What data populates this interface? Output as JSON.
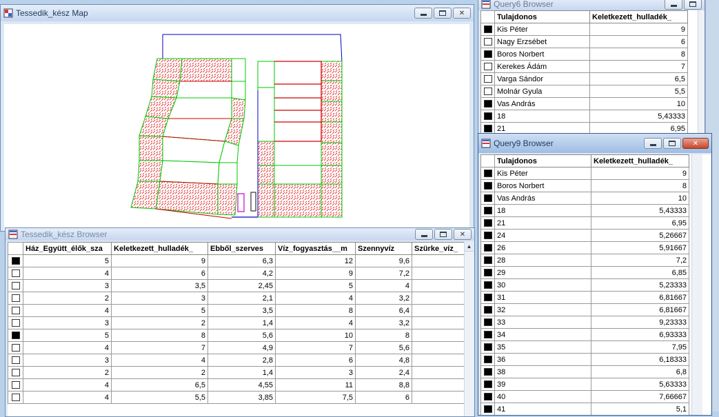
{
  "map_window": {
    "title": "Tessedik_kész Map"
  },
  "browser_window": {
    "title": "Tessedik_kész Browser",
    "columns": [
      "Ház_Együtt_élők_sza",
      "Keletkezett_hulladék_",
      "Ebből_szerves",
      "Víz_fogyasztás__m",
      "Szennyvíz",
      "Szürke_víz_"
    ],
    "rows": [
      {
        "selected": true,
        "cells": [
          "5",
          "9",
          "6,3",
          "12",
          "9,6",
          ""
        ]
      },
      {
        "selected": false,
        "cells": [
          "4",
          "6",
          "4,2",
          "9",
          "7,2",
          ""
        ]
      },
      {
        "selected": false,
        "cells": [
          "3",
          "3,5",
          "2,45",
          "5",
          "4",
          ""
        ]
      },
      {
        "selected": false,
        "cells": [
          "2",
          "3",
          "2,1",
          "4",
          "3,2",
          ""
        ]
      },
      {
        "selected": false,
        "cells": [
          "4",
          "5",
          "3,5",
          "8",
          "6,4",
          ""
        ]
      },
      {
        "selected": false,
        "cells": [
          "3",
          "2",
          "1,4",
          "4",
          "3,2",
          ""
        ]
      },
      {
        "selected": true,
        "cells": [
          "5",
          "8",
          "5,6",
          "10",
          "8",
          ""
        ]
      },
      {
        "selected": false,
        "cells": [
          "4",
          "7",
          "4,9",
          "7",
          "5,6",
          ""
        ]
      },
      {
        "selected": false,
        "cells": [
          "3",
          "4",
          "2,8",
          "6",
          "4,8",
          ""
        ]
      },
      {
        "selected": false,
        "cells": [
          "2",
          "2",
          "1,4",
          "3",
          "2,4",
          ""
        ]
      },
      {
        "selected": false,
        "cells": [
          "4",
          "6,5",
          "4,55",
          "11",
          "8,8",
          ""
        ]
      },
      {
        "selected": false,
        "cells": [
          "4",
          "5,5",
          "3,85",
          "7,5",
          "6",
          ""
        ]
      }
    ]
  },
  "q6_window": {
    "title": "Query6 Browser",
    "columns": [
      "Tulajdonos",
      "Keletkezett_hulladék_"
    ],
    "rows": [
      {
        "selected": true,
        "cells": [
          "Kis Péter",
          "9"
        ]
      },
      {
        "selected": false,
        "cells": [
          "Nagy Erzsébet",
          "6"
        ]
      },
      {
        "selected": true,
        "cells": [
          "Boros Norbert",
          "8"
        ]
      },
      {
        "selected": false,
        "cells": [
          "Kerekes Ádám",
          "7"
        ]
      },
      {
        "selected": false,
        "cells": [
          "Varga Sándor",
          "6,5"
        ]
      },
      {
        "selected": false,
        "cells": [
          "Molnár Gyula",
          "5,5"
        ]
      },
      {
        "selected": true,
        "cells": [
          "Vas András",
          "10"
        ]
      },
      {
        "selected": true,
        "cells": [
          "18",
          "5,43333"
        ]
      },
      {
        "selected": true,
        "cells": [
          "21",
          "6,95"
        ]
      }
    ]
  },
  "q9_window": {
    "title": "Query9 Browser",
    "columns": [
      "Tulajdonos",
      "Keletkezett_hulladék_"
    ],
    "rows": [
      {
        "selected": true,
        "cells": [
          "Kis Péter",
          "9"
        ]
      },
      {
        "selected": true,
        "cells": [
          "Boros Norbert",
          "8"
        ]
      },
      {
        "selected": true,
        "cells": [
          "Vas András",
          "10"
        ]
      },
      {
        "selected": true,
        "cells": [
          "18",
          "5,43333"
        ]
      },
      {
        "selected": true,
        "cells": [
          "21",
          "6,95"
        ]
      },
      {
        "selected": true,
        "cells": [
          "24",
          "5,26667"
        ]
      },
      {
        "selected": true,
        "cells": [
          "26",
          "5,91667"
        ]
      },
      {
        "selected": true,
        "cells": [
          "28",
          "7,2"
        ]
      },
      {
        "selected": true,
        "cells": [
          "29",
          "6,85"
        ]
      },
      {
        "selected": true,
        "cells": [
          "30",
          "5,23333"
        ]
      },
      {
        "selected": true,
        "cells": [
          "31",
          "6,81667"
        ]
      },
      {
        "selected": true,
        "cells": [
          "32",
          "6,81667"
        ]
      },
      {
        "selected": true,
        "cells": [
          "33",
          "9,23333"
        ]
      },
      {
        "selected": true,
        "cells": [
          "34",
          "6,93333"
        ]
      },
      {
        "selected": true,
        "cells": [
          "35",
          "7,95"
        ]
      },
      {
        "selected": true,
        "cells": [
          "36",
          "6,18333"
        ]
      },
      {
        "selected": true,
        "cells": [
          "38",
          "6,8"
        ]
      },
      {
        "selected": true,
        "cells": [
          "39",
          "5,63333"
        ]
      },
      {
        "selected": true,
        "cells": [
          "40",
          "7,66667"
        ]
      },
      {
        "selected": true,
        "cells": [
          "41",
          "5,1"
        ]
      }
    ]
  },
  "icons": {
    "window_icon": "mapinfo-window-icon",
    "minimize": "minimize-icon",
    "maximize": "maximize-icon",
    "close": "close-icon"
  },
  "colors": {
    "parcel_outline": "#00c800",
    "hatch": "#e03030",
    "boundary": "#0000c0",
    "highlight_line": "#d00000",
    "marker_magenta": "#cc00cc"
  }
}
